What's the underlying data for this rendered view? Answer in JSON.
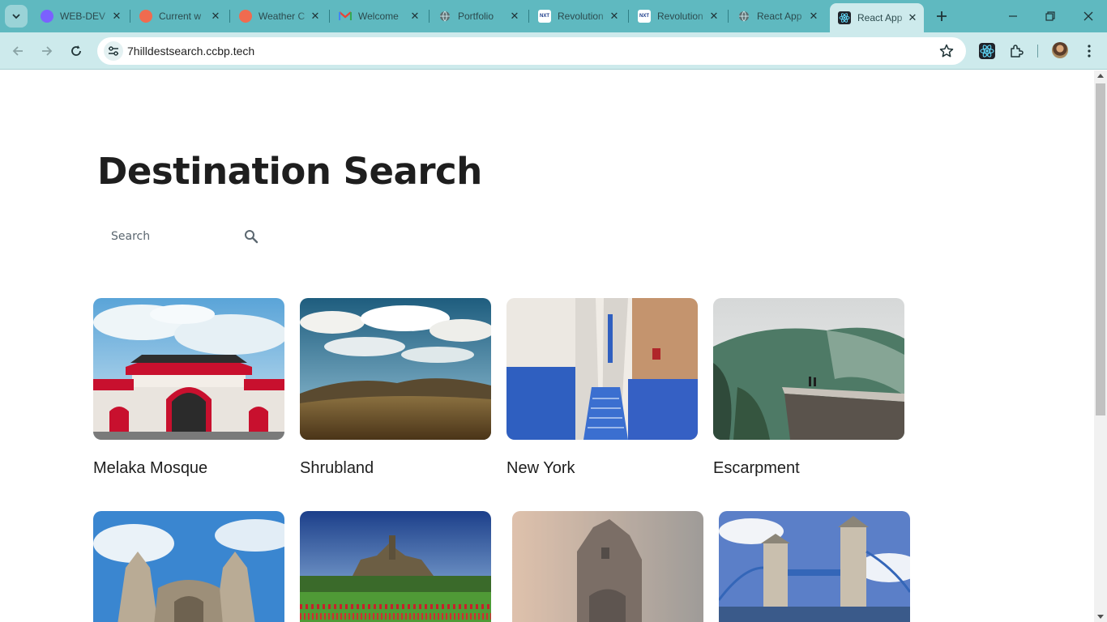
{
  "browser": {
    "tabs": [
      {
        "label": "WEB-DEV",
        "icon": "purple-badge-icon"
      },
      {
        "label": "Current w",
        "icon": "red-orange-dot-icon"
      },
      {
        "label": "Weather C",
        "icon": "red-orange-dot-icon"
      },
      {
        "label": "Welcome",
        "icon": "gmail-icon"
      },
      {
        "label": "Portfolio",
        "icon": "globe-icon"
      },
      {
        "label": "Revolution",
        "icon": "nxt-wave-icon"
      },
      {
        "label": "Revolution",
        "icon": "nxt-wave-icon"
      },
      {
        "label": "React App",
        "icon": "globe-icon"
      },
      {
        "label": "React App",
        "icon": "react-icon",
        "active": true
      }
    ],
    "url": "7hilldestsearch.ccbp.tech",
    "colors": {
      "chrome": "#5fb9c0",
      "toolbar": "#cdeaec",
      "active_tab": "#cdeaec"
    }
  },
  "app": {
    "title": "Destination Search",
    "search": {
      "placeholder": "Search",
      "value": ""
    },
    "destinations": [
      {
        "name": "Melaka Mosque"
      },
      {
        "name": "Shrubland"
      },
      {
        "name": "New York"
      },
      {
        "name": "Escarpment"
      },
      {
        "name": ""
      },
      {
        "name": ""
      },
      {
        "name": ""
      },
      {
        "name": ""
      }
    ]
  }
}
